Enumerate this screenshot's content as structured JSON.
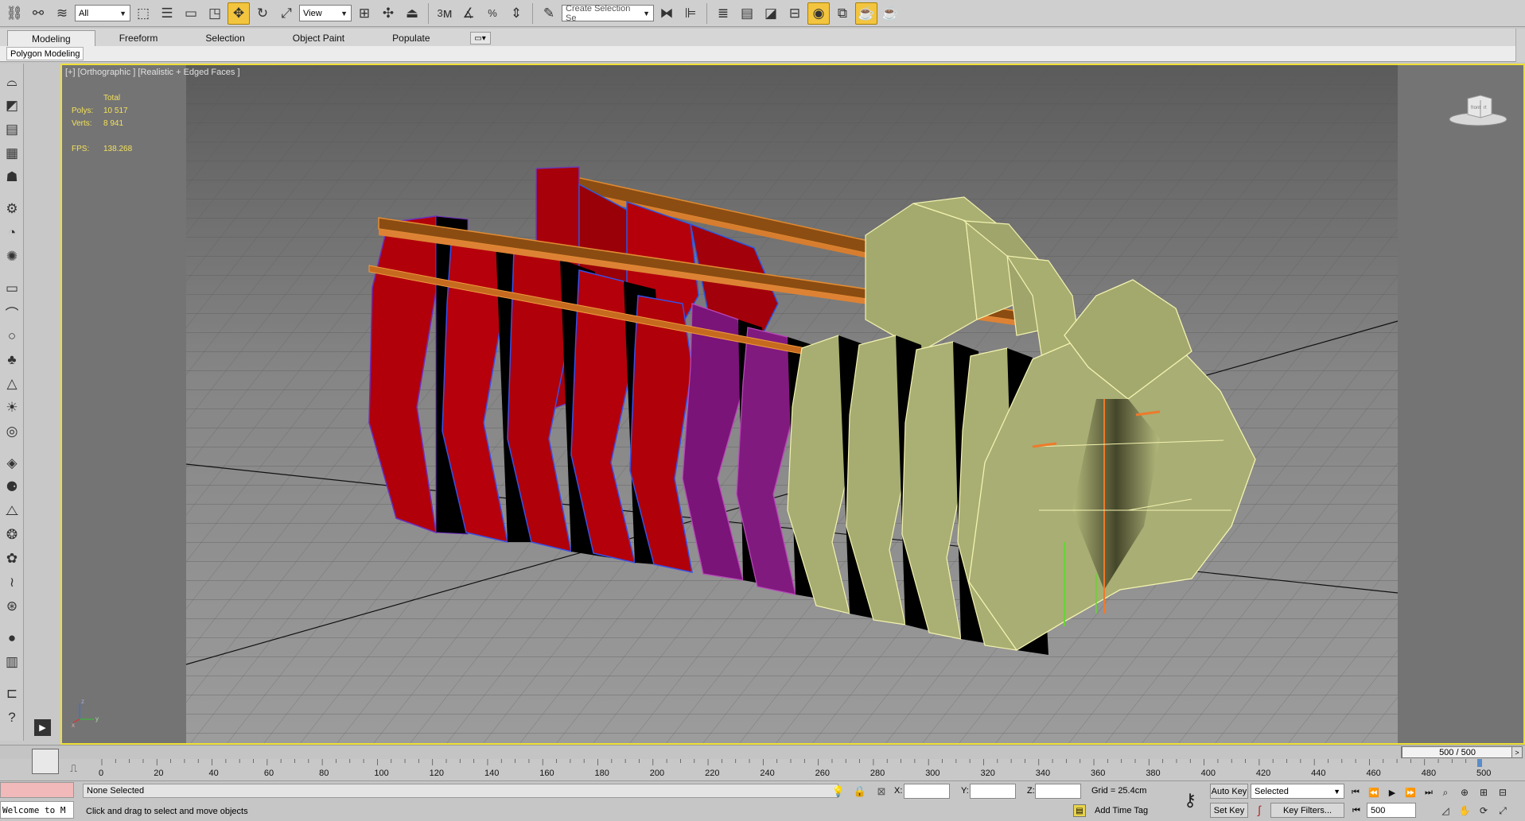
{
  "toolbar": {
    "selection_filter": "All",
    "reference_coord": "View",
    "named_selection_placeholder": "Create Selection Se",
    "snap_labels": {
      "snap3": "3",
      "angle": "",
      "percent": "%",
      "spinner": ""
    }
  },
  "ribbon": {
    "tabs": [
      {
        "label": "Modeling",
        "active": true
      },
      {
        "label": "Freeform",
        "active": false
      },
      {
        "label": "Selection",
        "active": false
      },
      {
        "label": "Object Paint",
        "active": false
      },
      {
        "label": "Populate",
        "active": false
      }
    ],
    "panel_label": "Polygon Modeling"
  },
  "viewport": {
    "label": "[+] [Orthographic ] [Realistic + Edged Faces ]",
    "stats": {
      "header": "Total",
      "polys_label": "Polys:",
      "polys_value": "10 517",
      "verts_label": "Verts:",
      "verts_value": "8 941",
      "fps_label": "FPS:",
      "fps_value": "138.268"
    },
    "viewcube_labels": {
      "front": "front",
      "right": "rt"
    },
    "axis_labels": {
      "x": "x",
      "y": "y",
      "z": "z"
    }
  },
  "timeline": {
    "slider_text": "500 / 500",
    "ticks": [
      "0",
      "20",
      "40",
      "60",
      "80",
      "100",
      "120",
      "140",
      "160",
      "180",
      "200",
      "220",
      "240",
      "260",
      "280",
      "300",
      "320",
      "340",
      "360",
      "380",
      "400",
      "420",
      "440",
      "460",
      "480",
      "500"
    ],
    "current_frame": 500,
    "total_frames": 500
  },
  "status": {
    "maxscript_text": "Welcome to M",
    "selection": "None Selected",
    "prompt": "Click and drag to select and move objects",
    "x_label": "X:",
    "y_label": "Y:",
    "z_label": "Z:",
    "x_value": "",
    "y_value": "",
    "z_value": "",
    "grid": "Grid = 25.4cm",
    "add_time_tag": "Add Time Tag",
    "auto_key": "Auto Key",
    "set_key": "Set Key",
    "key_mode": "Selected",
    "key_filters": "Key Filters...",
    "frame_value": "500"
  },
  "colors": {
    "accent_active": "#f3c53f",
    "viewport_border": "#efe036",
    "stats_text": "#f3e15a",
    "red_material": "#b3000b",
    "purple_material": "#7a1478",
    "olive_material": "#a9ae72"
  }
}
